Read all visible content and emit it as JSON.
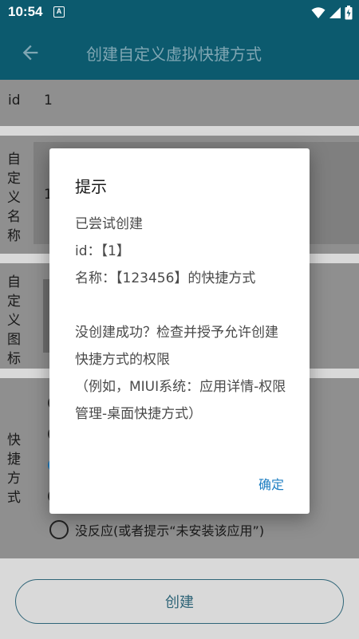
{
  "status_bar": {
    "time": "10:54",
    "notification_icon": "a-letter-icon",
    "icons": [
      "wifi-icon",
      "signal-icon",
      "battery-icon"
    ]
  },
  "app_bar": {
    "title": "创建自定义虚拟快捷方式",
    "back_icon": "back-arrow-icon"
  },
  "form": {
    "id_label": "id",
    "id_value": "1",
    "name_label": "自定义名称",
    "name_value": "1",
    "icon_label": "自定义图标",
    "shortcut_label": "快捷方式",
    "last_option_label": "没反应(或者提示“未安装该应用”)",
    "create_button": "创建"
  },
  "dialog": {
    "title": "提示",
    "lines": [
      "已尝试创建",
      "id：【1】",
      "名称：【123456】的快捷方式",
      "",
      "没创建成功？检查并授予允许创建快捷方式的权限",
      "（例如，MIUI系统：应用详情-权限管理-桌面快捷方式）"
    ],
    "ok_button": "确定"
  },
  "colors": {
    "primary": "#0c5a6e",
    "accent": "#1e7ec2",
    "button_outline": "#2f6578"
  }
}
